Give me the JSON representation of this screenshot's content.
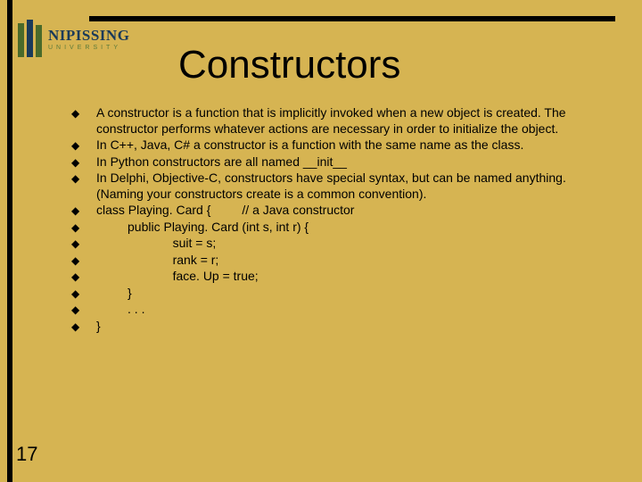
{
  "logo": {
    "main": "NIPISSING",
    "sub": "UNIVERSITY"
  },
  "title": "Constructors",
  "bullets": [
    "A constructor is a function that is implicitly invoked when a new object is created. The constructor performs whatever actions are necessary in order to initialize the object.",
    "In C++, Java, C# a constructor is a function with the same name as the class.",
    "In Python constructors are all named __init__",
    "In Delphi, Objective-C, constructors have special syntax, but can be named anything. (Naming your constructors create is a common convention).",
    "class Playing. Card {         // a Java constructor",
    "         public Playing. Card (int s, int r) {",
    "                      suit = s;",
    "                      rank = r;",
    "                      face. Up = true;",
    "         }",
    "         . . .",
    "}"
  ],
  "pageNumber": "17"
}
